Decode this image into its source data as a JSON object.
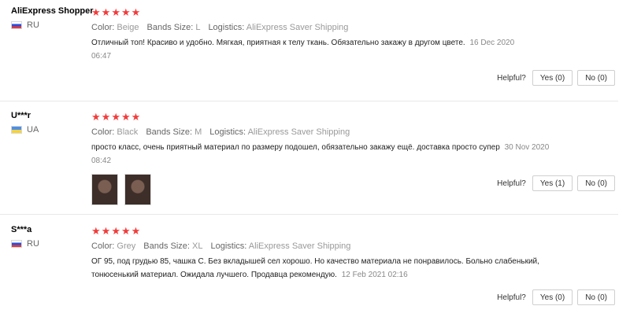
{
  "labels": {
    "color": "Color:",
    "bands_size": "Bands Size:",
    "logistics": "Logistics:",
    "helpful": "Helpful?"
  },
  "reviews": [
    {
      "user": "AliExpress Shopper",
      "country": "RU",
      "flag": "ru",
      "stars": 5,
      "color": "Beige",
      "bands_size": "L",
      "logistics": "AliExpress Saver Shipping",
      "text": "Отличный топ! Красиво и удобно. Мягкая, приятная к телу ткань. Обязательно закажу в другом цвете.",
      "date": "16 Dec 2020 06:47",
      "yes": "Yes (0)",
      "no": "No (0)"
    },
    {
      "user": "U***r",
      "country": "UA",
      "flag": "ua",
      "stars": 5,
      "color": "Black",
      "bands_size": "M",
      "logistics": "AliExpress Saver Shipping",
      "text": "просто класс, очень приятный материал по размеру подошел, обязательно закажу ещё. доставка просто супер",
      "date": "30 Nov 2020 08:42",
      "yes": "Yes (1)",
      "no": "No (0)"
    },
    {
      "user": "S***a",
      "country": "RU",
      "flag": "ru",
      "stars": 5,
      "color": "Grey",
      "bands_size": "XL",
      "logistics": "AliExpress Saver Shipping",
      "text": "ОГ 95, под грудью 85, чашка С. Без вкладышей сел хорошо. Но качество материала не понравилось. Больно слабенький, тонюсенький материал. Ожидала лучшего. Продавца рекомендую.",
      "date": "12 Feb 2021 02:16",
      "yes": "Yes (0)",
      "no": "No (0)"
    }
  ]
}
